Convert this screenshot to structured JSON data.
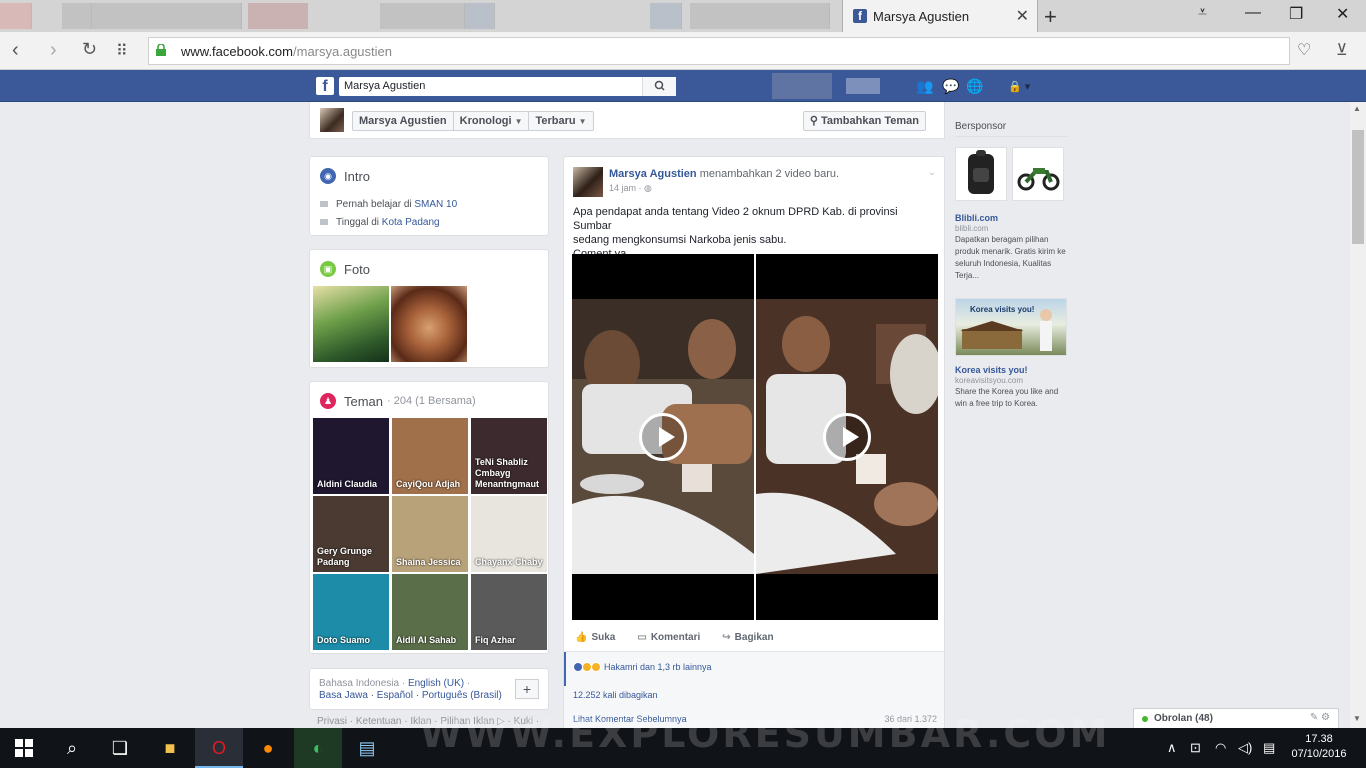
{
  "browser": {
    "tab_title": "Marsya Agustien",
    "url_host": "www.facebook.com",
    "url_path": "/marsya.agustien"
  },
  "fb_header": {
    "search_value": "Marsya Agustien"
  },
  "profile_nav": {
    "name": "Marsya Agustien",
    "timeline": "Kronologi",
    "recent": "Terbaru",
    "add_friend": "Tambahkan Teman"
  },
  "intro": {
    "title": "Intro",
    "studied_prefix": "Pernah belajar di",
    "studied_link": "SMAN 10",
    "lives_prefix": "Tinggal di",
    "lives_link": "Kota Padang"
  },
  "photos": {
    "title": "Foto"
  },
  "friends": {
    "title": "Teman",
    "count": "· 204 (1 Bersama)",
    "list": [
      {
        "name": "Aldini Claudia",
        "color": "#1f1630"
      },
      {
        "name": "CayiQou Adjah",
        "color": "#a0704a"
      },
      {
        "name": "TeNi Shabliz Cmbayg Menantngmaut",
        "color": "#3c2a2e"
      },
      {
        "name": "Gery Grunge Padang",
        "color": "#4a3a32"
      },
      {
        "name": "Shaina Jessica",
        "color": "#b8a27a"
      },
      {
        "name": "Chayanx Chaby",
        "color": "#e8e4de"
      },
      {
        "name": "Doto Suamo",
        "color": "#1c8ca8"
      },
      {
        "name": "Aidil Al Sahab",
        "color": "#5b6e4a"
      },
      {
        "name": "Fiq Azhar",
        "color": "#5a5a5a"
      }
    ]
  },
  "languages": {
    "line1_current": "Bahasa Indonesia ·",
    "line1_link": "English (UK)",
    "line1_tail": "·",
    "line2": "Basa Jawa · Español · Português (Brasil)",
    "plus": "+"
  },
  "footer": {
    "links": "Privasi · Ketentuan · Iklan · Pilihan Iklan ▷ · Kuki ·"
  },
  "post": {
    "author": "Marsya Agustien",
    "action": "menambahkan 2 video baru.",
    "time": "14 jam ·",
    "text_line1": "Apa pendapat anda tentang Video 2 oknum DPRD Kab. di provinsi Sumbar",
    "text_line2": "sedang mengkonsumsi Narkoba jenis sabu.",
    "text_line3": "Coment ya....",
    "like": "Suka",
    "comment": "Komentari",
    "share": "Bagikan",
    "reactions": "Hakamri dan 1,3 rb lainnya",
    "shares": "12.252 kali dibagikan",
    "more_comments": "Lihat Komentar Sebelumnya",
    "comment_count": "36 dari 1.372"
  },
  "sponsored": {
    "title": "Bersponsor",
    "ads": [
      {
        "title": "Blibli.com",
        "domain": "blibli.com",
        "body": "Dapatkan beragam pilihan produk menarik. Gratis kirim ke seluruh Indonesia, Kualitas Terja..."
      },
      {
        "title": "Korea visits you!",
        "domain": "koreavisitsyou.com",
        "body": "Share the Korea you like and win a free trip to Korea.",
        "banner_text": "Korea visits you!"
      }
    ]
  },
  "chat": {
    "label": "Obrolan (48)"
  },
  "taskbar": {
    "time": "17.38",
    "date": "07/10/2016"
  },
  "watermark": "WWW.EXPLORESUMBAR.COM"
}
